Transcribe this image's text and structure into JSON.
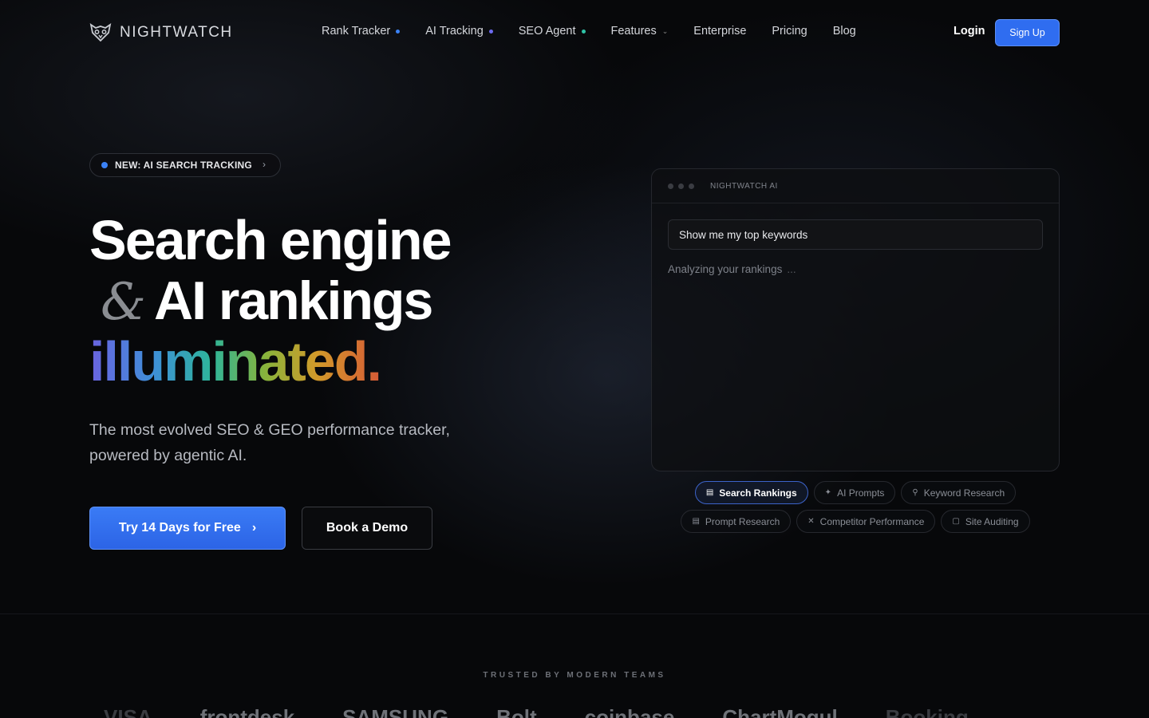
{
  "nav": {
    "logo_text": "NIGHTWATCH",
    "links": [
      {
        "label": "Rank Tracker",
        "dot_color": "#3b82f6"
      },
      {
        "label": "AI Tracking",
        "dot_color": "#6d6bf0"
      },
      {
        "label": "SEO Agent",
        "dot_color": "#2fc3a6"
      },
      {
        "label": "Features"
      },
      {
        "label": "Enterprise"
      },
      {
        "label": "Pricing"
      },
      {
        "label": "Blog"
      }
    ],
    "login_label": "Login",
    "signup_label": "Sign Up"
  },
  "hero": {
    "badge_label": "NEW: AI SEARCH TRACKING",
    "headline_line1": "Search engine",
    "headline_amp": "&",
    "headline_line2": "AI rankings",
    "headline_line3": "illuminated.",
    "subtitle": "The most evolved SEO & GEO performance tracker, powered by agentic AI.",
    "cta_primary": "Try 14 Days for Free",
    "cta_secondary": "Book a Demo"
  },
  "ai_panel": {
    "title": "NIGHTWATCH AI",
    "input_value": "Show me my top keywords",
    "status_text": "Analyzing your rankings",
    "status_ellipsis": "...",
    "chips_row1": [
      {
        "label": "Search Rankings",
        "icon": "bar-chart-icon",
        "active": true
      },
      {
        "label": "AI Prompts",
        "icon": "ai-icon"
      },
      {
        "label": "Keyword Research",
        "icon": "search-icon"
      }
    ],
    "chips_row2": [
      {
        "label": "Prompt Research",
        "icon": "message-icon"
      },
      {
        "label": "Competitor Performance",
        "icon": "swords-icon"
      },
      {
        "label": "Site Auditing",
        "icon": "clipboard-icon"
      }
    ]
  },
  "trusted": {
    "label": "TRUSTED BY MODERN TEAMS",
    "brands": [
      "VISA",
      "frontdesk",
      "SAMSUNG",
      "Bolt",
      "coinbase",
      "ChartMogul",
      "Booking"
    ]
  },
  "colors": {
    "accent": "#2f6df0",
    "background": "#07080a"
  }
}
